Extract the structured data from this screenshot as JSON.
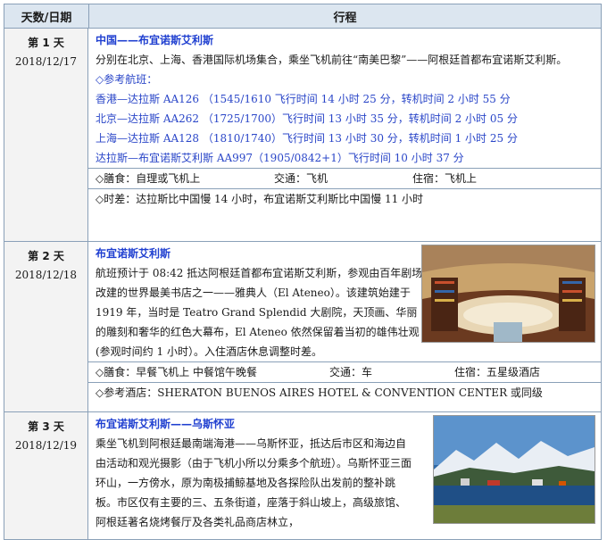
{
  "table": {
    "col_day": "天数/日期",
    "col_itinerary": "行程"
  },
  "days": [
    {
      "day": "第 1 天",
      "date": "2018/12/17",
      "title": "中国——布宜诺斯艾利斯",
      "desc": "分别在北京、上海、香港国际机场集合，乘坐飞机前往“南美巴黎”——阿根廷首都布宜诺斯艾利斯。",
      "flight_header": "◇参考航班：",
      "flights": [
        "香港—达拉斯 AA126 （1545/1610 飞行时间 14 小时 25 分，转机时间 2 小时 55 分",
        "北京—达拉斯 AA262 （1725/1700）飞行时间 13 小时 35 分，转机时间 2 小时 05 分",
        "上海—达拉斯 AA128 （1810/1740）飞行时间 13 小时 30 分，转机时间 1 小时 25 分",
        "达拉斯—布宜诺斯艾利斯 AA997（1905/0842+1）飞行时间 10 小时 37 分"
      ],
      "meals": "◇膳食：自理或飞机上",
      "transport": "交通：飞机",
      "hotel": "住宿：飞机上",
      "timediff": "◇时差：达拉斯比中国慢 14 小时，布宜诺斯艾利斯比中国慢 11 小时"
    },
    {
      "day": "第 2 天",
      "date": "2018/12/18",
      "title": "布宜诺斯艾利斯",
      "desc": "航班预计于 08:42 抵达阿根廷首都布宜诺斯艾利斯，参观由百年剧场改建的世界最美书店之一——雅典人（El Ateneo）。该建筑始建于 1919 年，当时是 Teatro Grand Splendid 大剧院，天顶画、华丽的雕刻和奢华的红色大幕布，El Ateneo 依然保留着当初的雄伟壮观(参观时间约 1 小时）。入住酒店休息调整时差。",
      "meals": "◇膳食：早餐飞机上 中餐馆午晚餐",
      "transport": "交通：车",
      "hotel": "住宿：五星级酒店",
      "ref_hotel": "◇参考酒店：SHERATON BUENOS AIRES HOTEL & CONVENTION CENTER 或同级"
    },
    {
      "day": "第 3 天",
      "date": "2018/12/19",
      "title": "布宜诺斯艾利斯——乌斯怀亚",
      "desc": "乘坐飞机到阿根廷最南端海港——乌斯怀亚，抵达后市区和海边自由活动和观光摄影（由于飞机小所以分乘多个航班）。乌斯怀亚三面环山，一方傍水，原为南极捕鲸基地及各探险队出发前的整补跳板。市区仅有主要的三、五条街道，座落于斜山坡上，高级旅馆、阿根廷著名烧烤餐厅及各类礼品商店林立，"
    }
  ]
}
